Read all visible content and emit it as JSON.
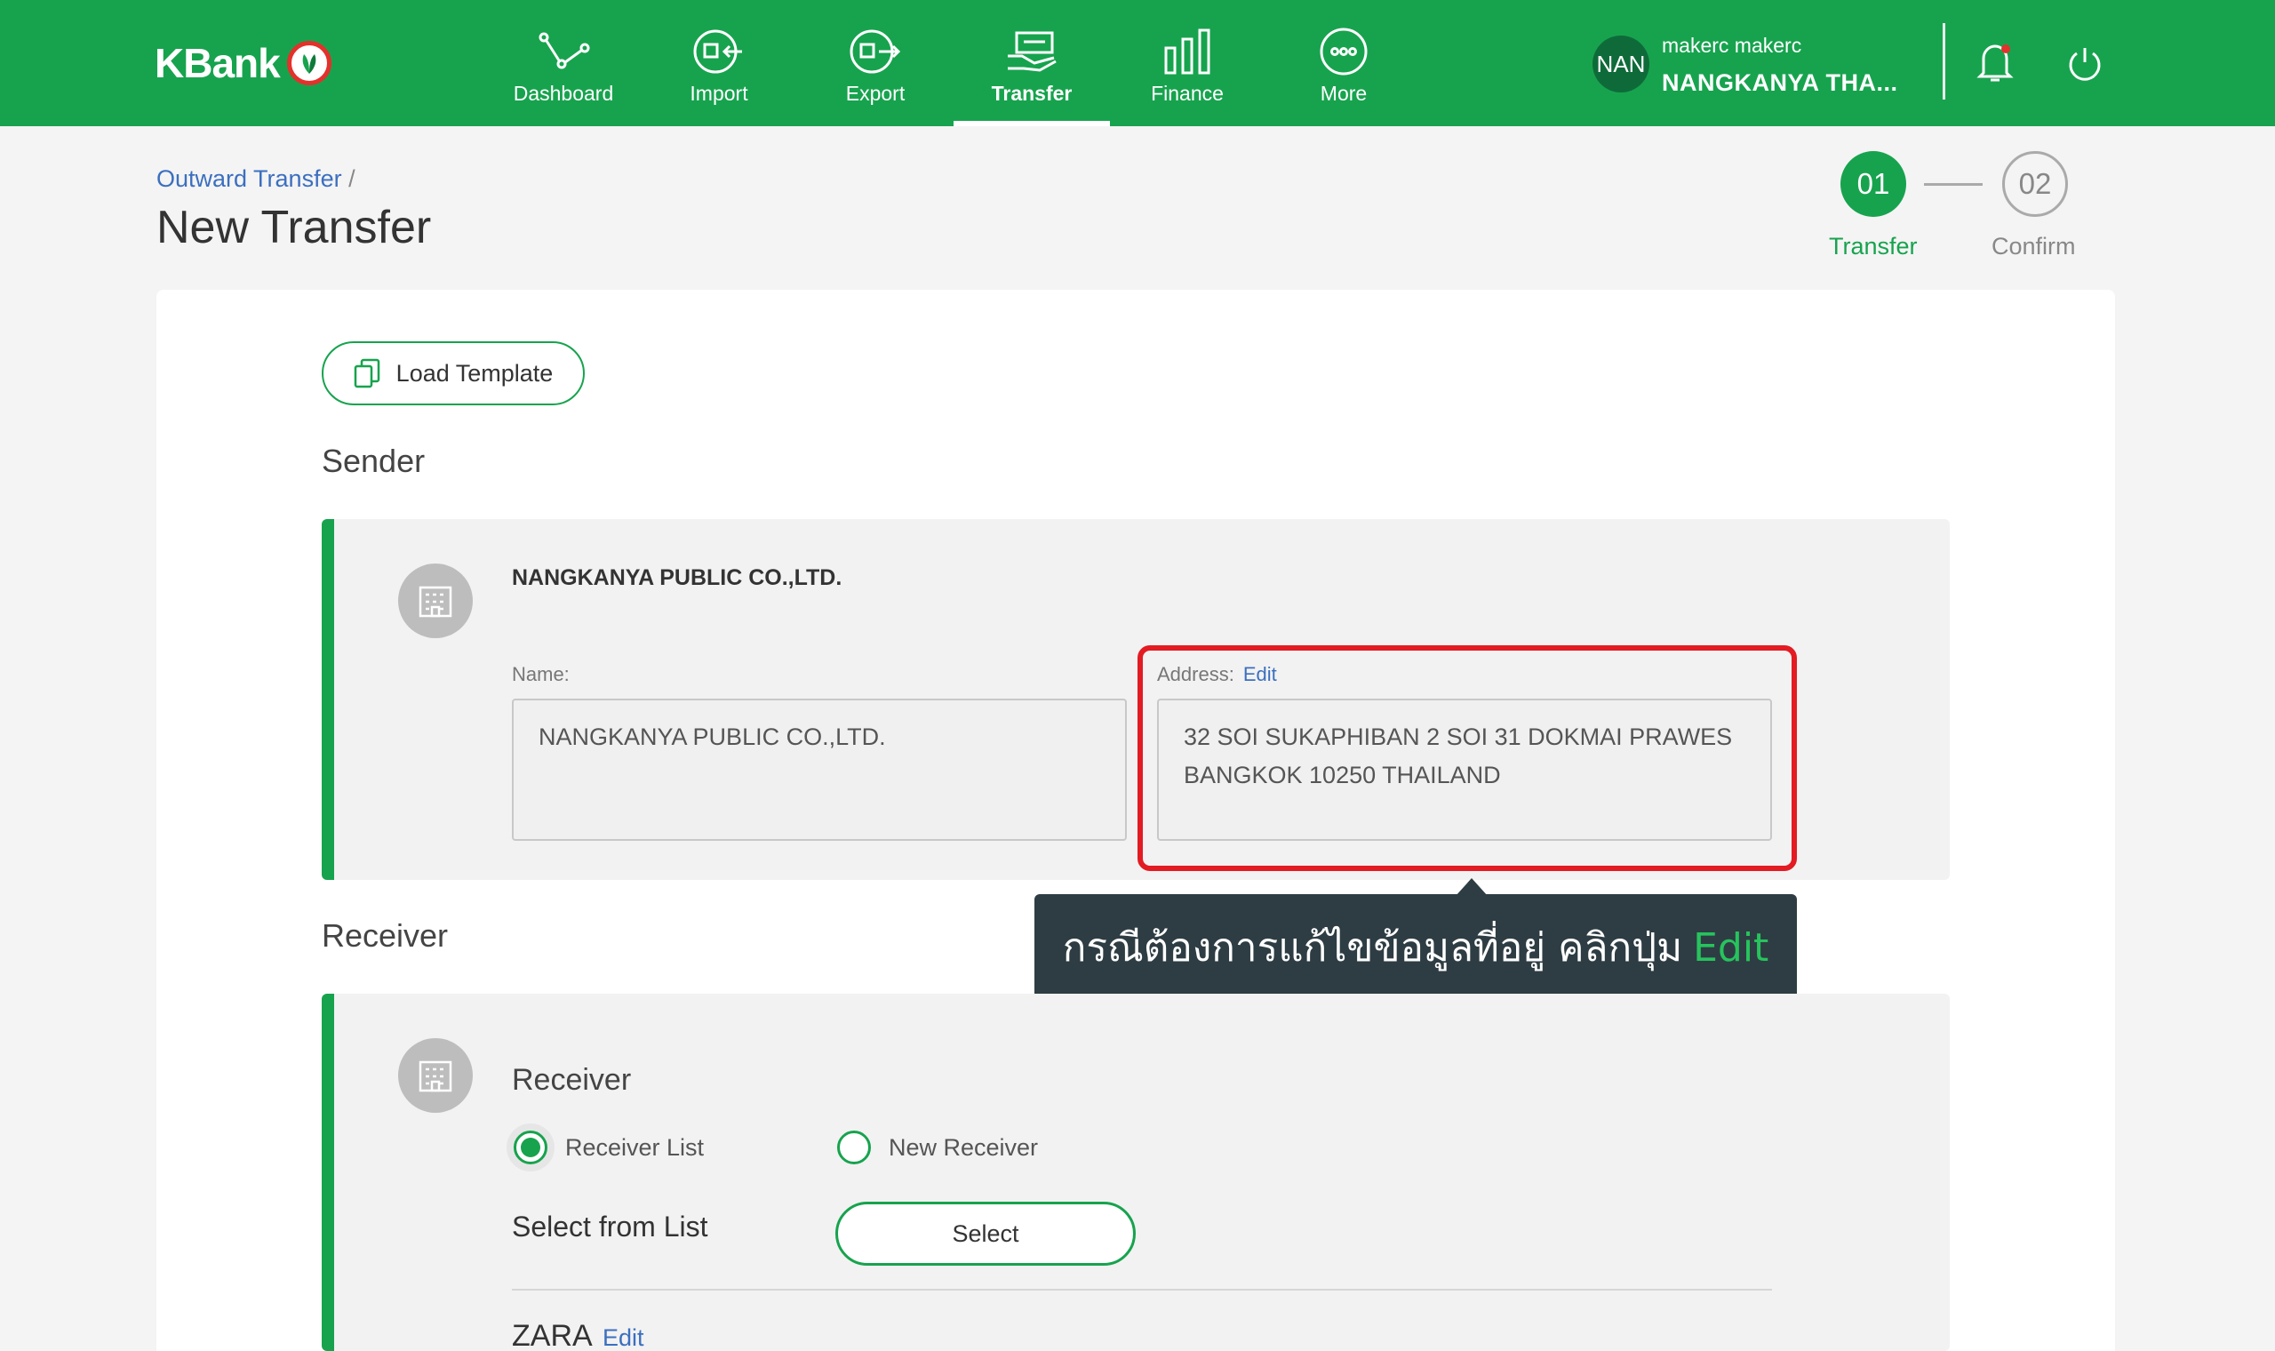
{
  "brand": {
    "name": "KBank"
  },
  "nav": [
    {
      "label": "Dashboard",
      "icon": "dashboard-icon"
    },
    {
      "label": "Import",
      "icon": "import-icon"
    },
    {
      "label": "Export",
      "icon": "export-icon"
    },
    {
      "label": "Transfer",
      "icon": "transfer-icon",
      "active": true
    },
    {
      "label": "Finance",
      "icon": "finance-icon"
    },
    {
      "label": "More",
      "icon": "more-icon"
    }
  ],
  "user": {
    "initials": "NAN",
    "username": "makerc makerc",
    "company": "NANGKANYA THA..."
  },
  "breadcrumb": {
    "parent": "Outward Transfer",
    "separator": "/"
  },
  "page": {
    "title": "New Transfer"
  },
  "steps": [
    {
      "number": "01",
      "label": "Transfer",
      "active": true
    },
    {
      "number": "02",
      "label": "Confirm",
      "active": false
    }
  ],
  "load_template": {
    "label": "Load Template"
  },
  "sender": {
    "section_title": "Sender",
    "company": "NANGKANYA PUBLIC CO.,LTD.",
    "name_label": "Name:",
    "name_value": "NANGKANYA PUBLIC CO.,LTD.",
    "address_label": "Address:",
    "address_edit": "Edit",
    "address_line1": "32 SOI SUKAPHIBAN 2 SOI 31 DOKMAI PRAWES",
    "address_line2": "BANGKOK 10250 THAILAND"
  },
  "tooltip": {
    "text": "กรณีต้องการแก้ไขข้อมูลที่อยู่ คลิกปุ่ม",
    "highlight": "Edit"
  },
  "receiver": {
    "section_title": "Receiver",
    "heading": "Receiver",
    "options": [
      "Receiver List",
      "New Receiver"
    ],
    "selected_option": "Receiver List",
    "select_from_label": "Select from List",
    "select_button": "Select",
    "selected_name": "ZARA",
    "selected_edit": "Edit"
  },
  "colors": {
    "brand_green": "#17a34e",
    "highlight_red": "#e31b23",
    "link_blue": "#3c6fbf",
    "tooltip_bg": "#2e3d43"
  }
}
